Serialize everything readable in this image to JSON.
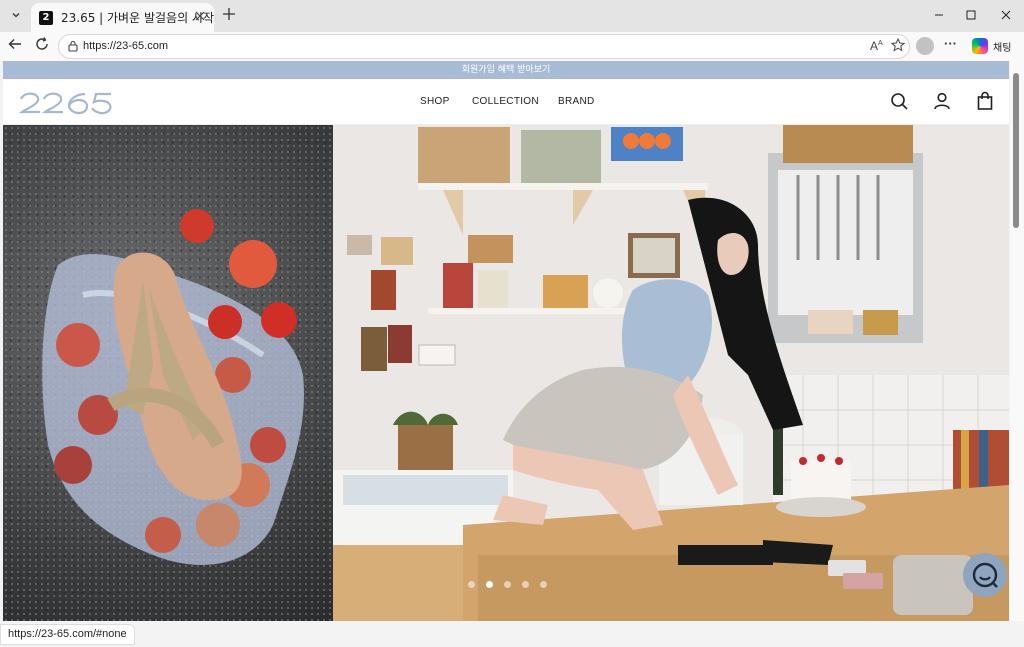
{
  "browser": {
    "tab_title": "23.65 | 가벼운 발걸음의 시작",
    "tab_favicon": "2",
    "url": "https://23-65.com",
    "copilot_label": "채팅",
    "status_url": "https://23-65.com/#none"
  },
  "icons": {
    "tab_menu": "chevron-down-icon",
    "tab_close": "close-icon",
    "new_tab": "plus-icon",
    "back": "back-arrow-icon",
    "reload": "reload-icon",
    "lock": "lock-icon",
    "read_aloud": "read-aloud-icon",
    "favorite": "star-icon",
    "more": "more-icon",
    "search": "search-icon",
    "account": "user-icon",
    "cart": "shopping-bag-icon",
    "chat": "chat-icon"
  },
  "site": {
    "promo_text": "회원가입 혜택 받아보기",
    "logo_text": "2365",
    "menu": [
      "SHOP",
      "COLLECTION",
      "BRAND"
    ],
    "slider": {
      "count": 5,
      "active": 2
    }
  },
  "colors": {
    "promo_bar": "#a7bbd6",
    "chat_button": "#8fa5bf"
  }
}
